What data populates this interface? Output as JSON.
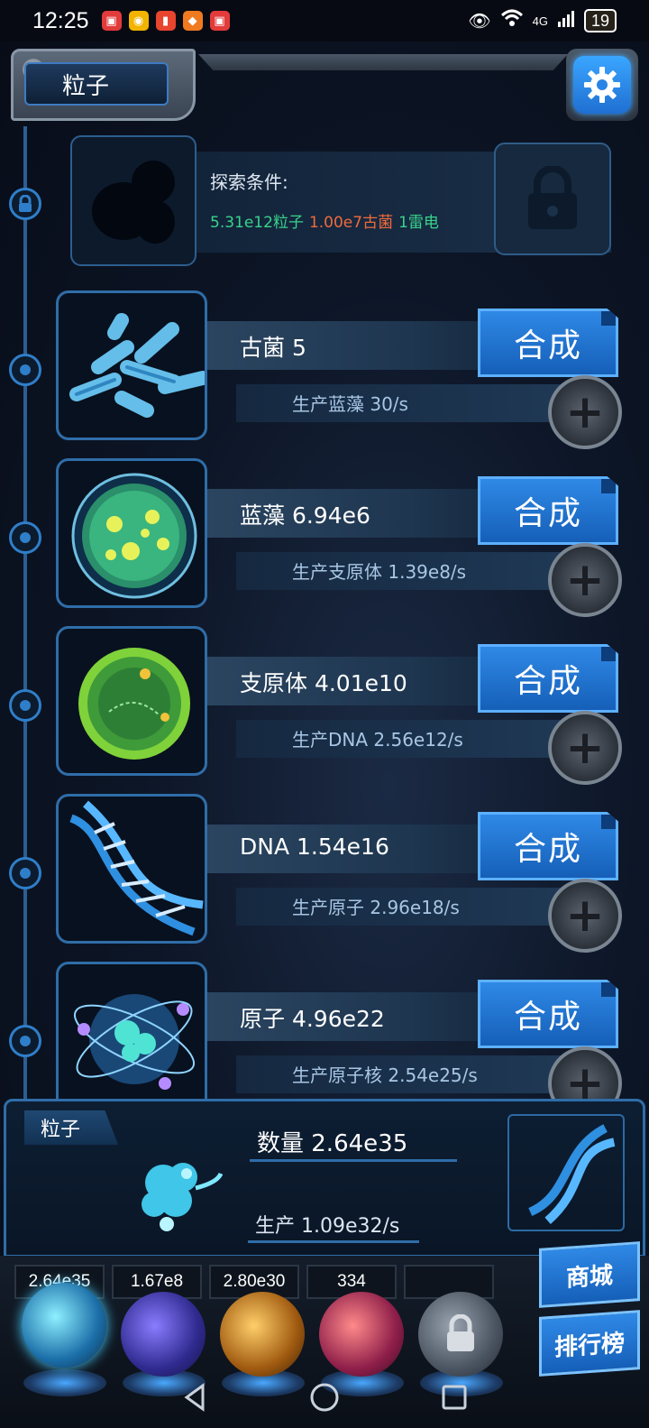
{
  "status": {
    "time": "12:25",
    "network": "4G",
    "battery": "19"
  },
  "header": {
    "title": "粒子"
  },
  "explore": {
    "label": "探索条件:",
    "req_particles": "5.31e12粒子",
    "req_archaea": "1.00e7古菌",
    "req_thunder": "1雷电"
  },
  "items": [
    {
      "name": "古菌 5",
      "prod": "生产蓝藻 30/s",
      "merge": "合成"
    },
    {
      "name": "蓝藻 6.94e6",
      "prod": "生产支原体 1.39e8/s",
      "merge": "合成"
    },
    {
      "name": "支原体 4.01e10",
      "prod": "生产DNA 2.56e12/s",
      "merge": "合成"
    },
    {
      "name": "DNA 1.54e16",
      "prod": "生产原子 2.96e18/s",
      "merge": "合成"
    },
    {
      "name": "原子 4.96e22",
      "prod": "生产原子核 2.54e25/s",
      "merge": "合成"
    }
  ],
  "summary": {
    "tab": "粒子",
    "quantity": "数量 2.64e35",
    "production": "生产 1.09e32/s"
  },
  "resources": [
    "2.64e35",
    "1.67e8",
    "2.80e30",
    "334",
    ""
  ],
  "side_buttons": {
    "shop": "商城",
    "rank": "排行榜"
  },
  "colors": {
    "accent": "#2f89e6",
    "green_req": "#39d38a",
    "orange_req": "#f06a3c"
  }
}
